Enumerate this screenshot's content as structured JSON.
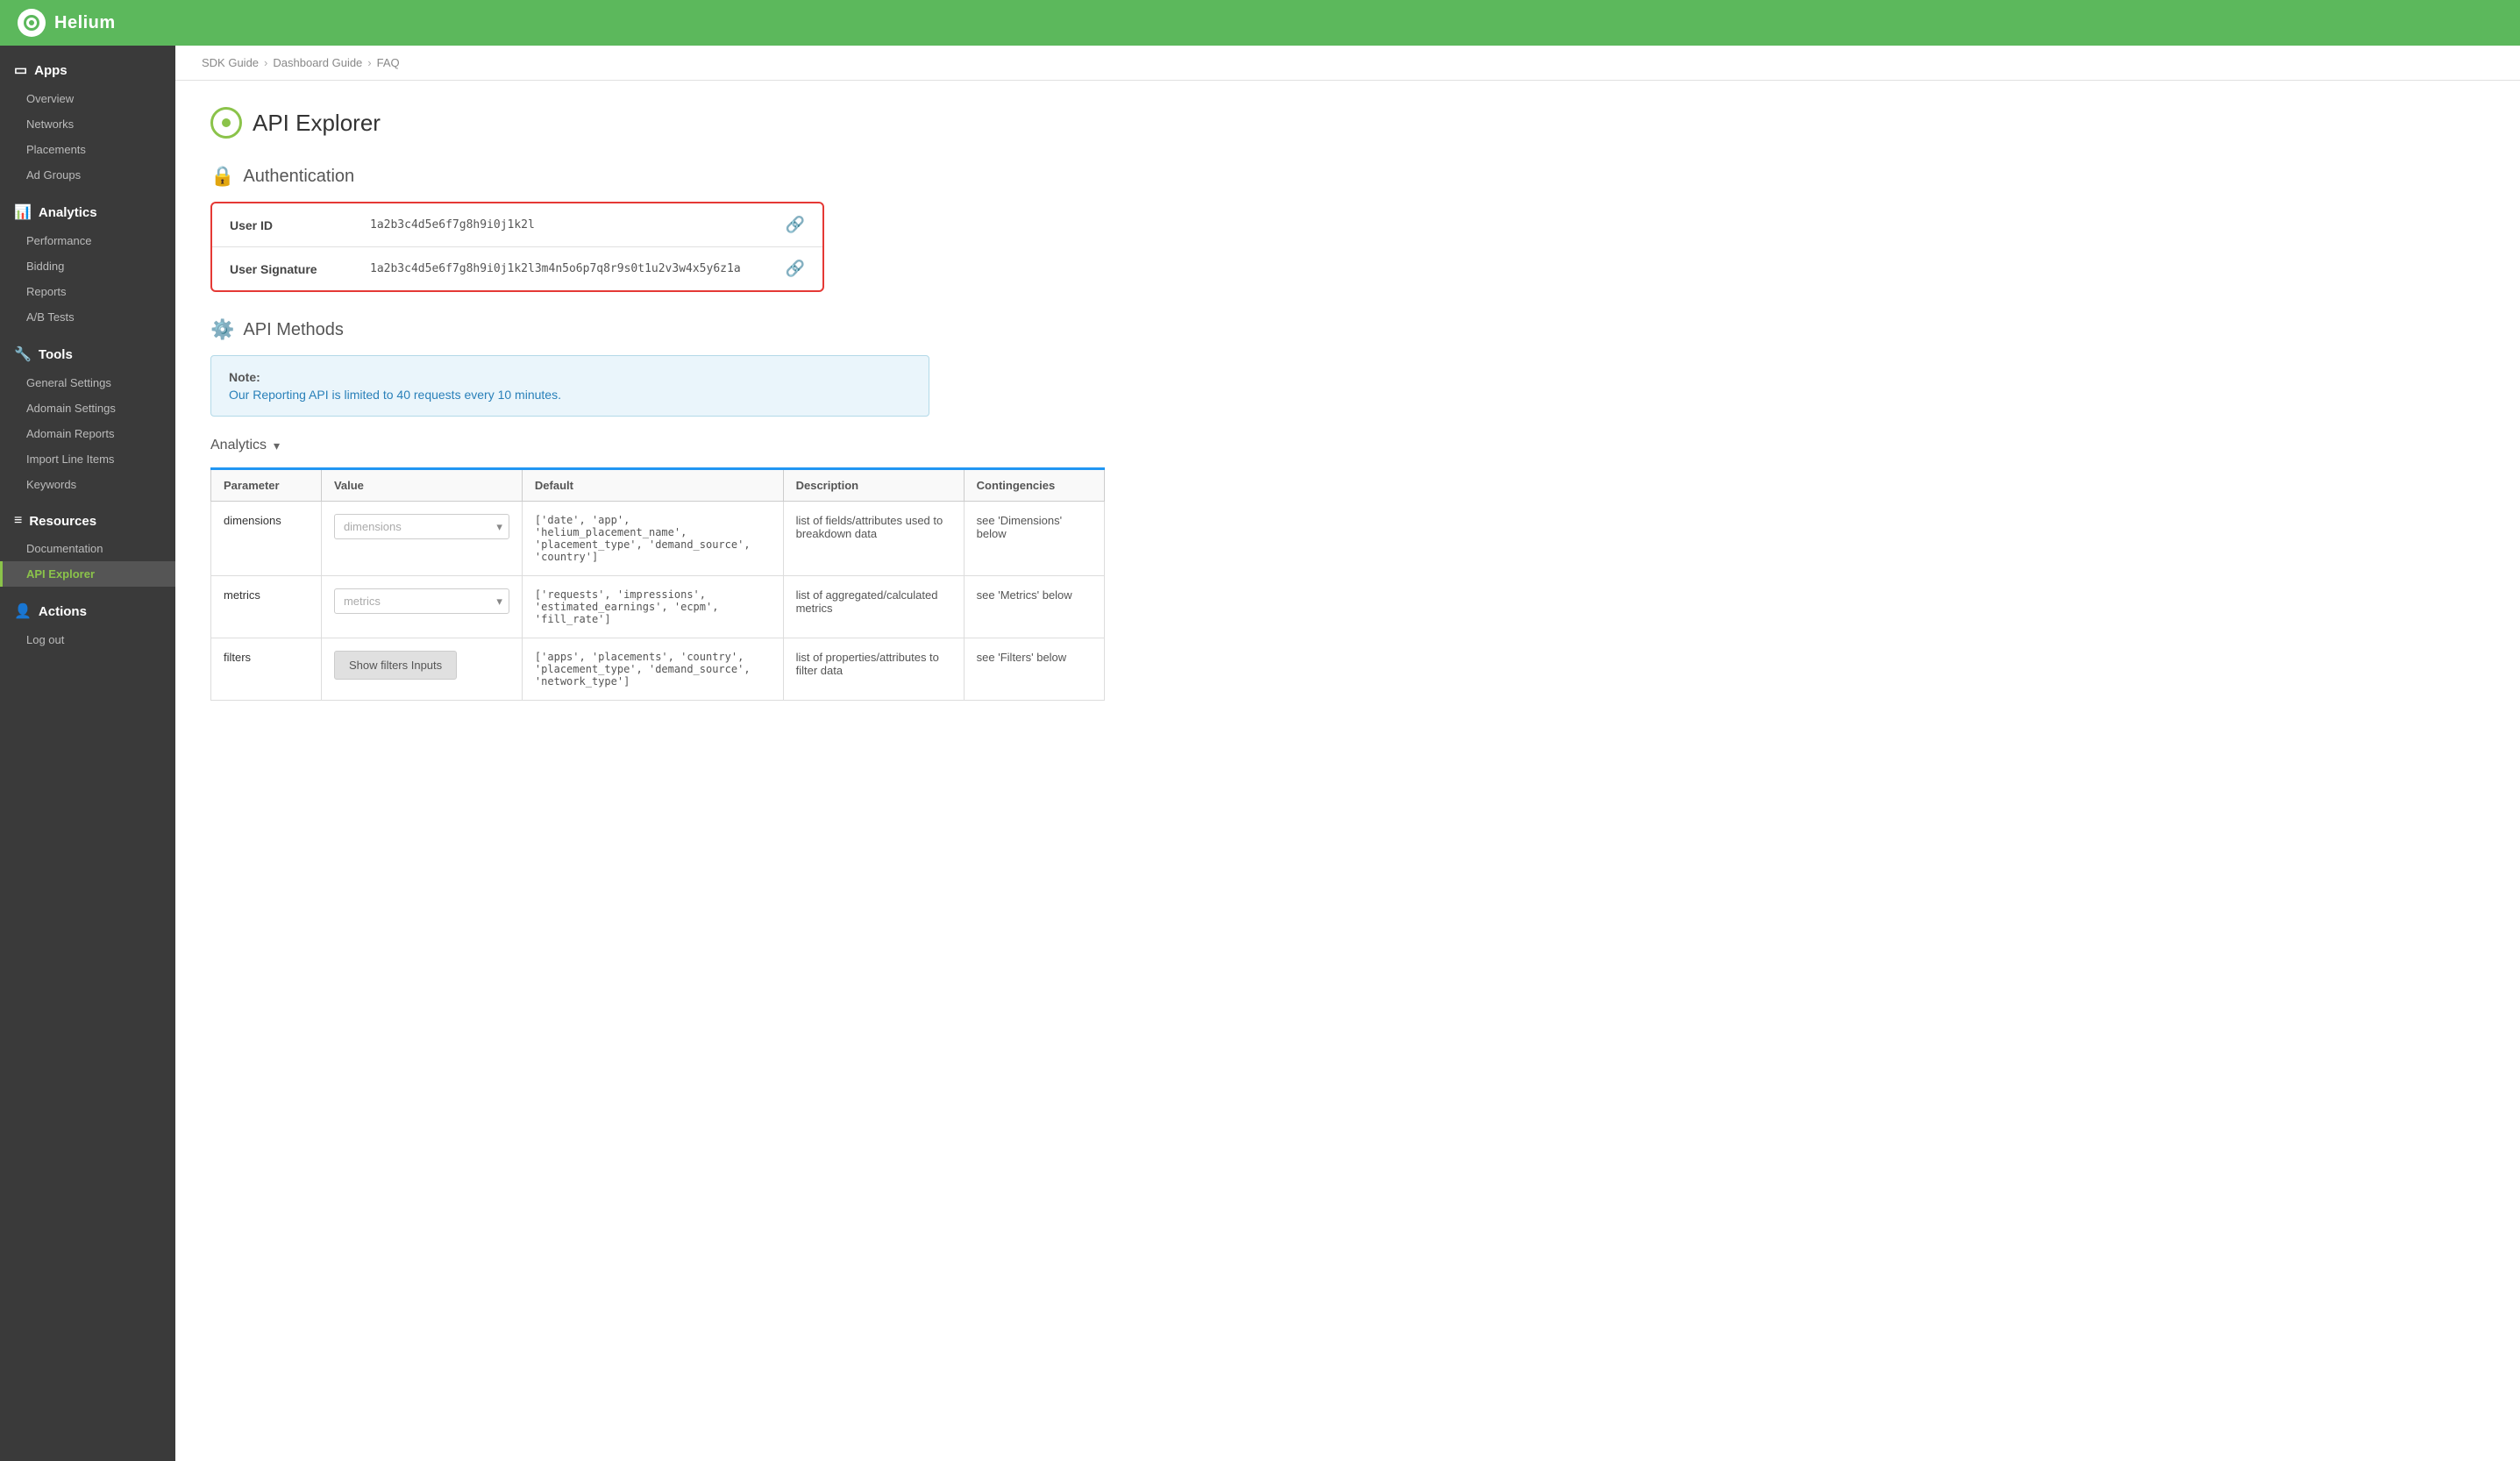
{
  "brand": {
    "name": "Helium"
  },
  "breadcrumb": {
    "items": [
      "SDK Guide",
      "Dashboard Guide",
      "FAQ"
    ]
  },
  "sidebar": {
    "sections": [
      {
        "id": "apps",
        "label": "Apps",
        "icon": "tablet",
        "items": [
          "Overview",
          "Networks",
          "Placements",
          "Ad Groups"
        ]
      },
      {
        "id": "analytics",
        "label": "Analytics",
        "icon": "bar-chart",
        "items": [
          "Performance",
          "Bidding",
          "Reports",
          "A/B Tests"
        ]
      },
      {
        "id": "tools",
        "label": "Tools",
        "icon": "wrench",
        "items": [
          "General Settings",
          "Adomain Settings",
          "Adomain Reports",
          "Import Line Items",
          "Keywords"
        ]
      },
      {
        "id": "resources",
        "label": "Resources",
        "icon": "list",
        "items": [
          "Documentation",
          "API Explorer"
        ]
      },
      {
        "id": "actions",
        "label": "Actions",
        "icon": "person",
        "items": [
          "Log out"
        ]
      }
    ],
    "active_item": "API Explorer"
  },
  "page": {
    "title": "API Explorer",
    "sections": {
      "authentication": {
        "label": "Authentication",
        "user_id_label": "User ID",
        "user_id_value": "1a2b3c4d5e6f7g8h9i0j1k2l",
        "user_signature_label": "User Signature",
        "user_signature_value": "1a2b3c4d5e6f7g8h9i0j1k2l3m4n5o6p7q8r9s0t1u2v3w4x5y6z1a"
      },
      "api_methods": {
        "label": "API Methods",
        "note_title": "Note:",
        "note_text": "Our Reporting API is limited to 40 requests every 10 minutes.",
        "analytics_label": "Analytics",
        "table_headers": [
          "Parameter",
          "Value",
          "Default",
          "Description",
          "Contingencies"
        ],
        "table_rows": [
          {
            "param": "dimensions",
            "value_placeholder": "dimensions",
            "default": "['date', 'app', 'helium_placement_name', 'placement_type', 'demand_source', 'country']",
            "description": "list of fields/attributes used to breakdown data",
            "contingencies": "see 'Dimensions' below"
          },
          {
            "param": "metrics",
            "value_placeholder": "metrics",
            "default": "['requests', 'impressions', 'estimated_earnings', 'ecpm', 'fill_rate']",
            "description": "list of aggregated/calculated metrics",
            "contingencies": "see 'Metrics' below"
          },
          {
            "param": "filters",
            "value_button": "Show filters Inputs",
            "default": "['apps', 'placements', 'country', 'placement_type', 'demand_source', 'network_type']",
            "description": "list of properties/attributes to filter data",
            "contingencies": "see 'Filters' below"
          }
        ]
      }
    }
  }
}
